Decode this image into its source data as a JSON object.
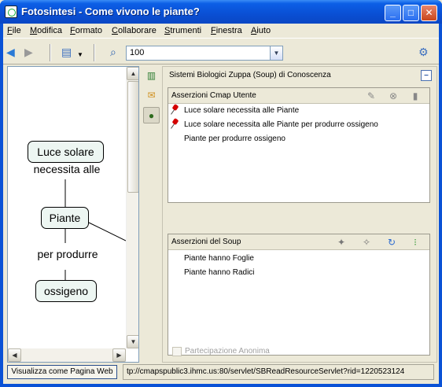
{
  "window": {
    "title": "Fotosintesi - Come vivono le piante?",
    "minimize": "_",
    "maximize": "□",
    "close": "✕"
  },
  "menu": [
    "File",
    "Modifica",
    "Formato",
    "Collaborare",
    "Strumenti",
    "Finestra",
    "Aiuto"
  ],
  "toolbar": {
    "back_icon": "arrow-left-icon",
    "forward_icon": "arrow-right-icon",
    "view_icon": "view-options-icon",
    "zoom_icon": "zoom-icon",
    "zoom_value": "100",
    "dropdown_glyph": "▼",
    "help_icon": "help-icon"
  },
  "map": {
    "nodes": [
      "Luce solare",
      "Piante",
      "ossigeno"
    ],
    "links": [
      "necessita alle",
      "per produrre"
    ]
  },
  "panel": {
    "title": "Sistemi Biologici Zuppa (Soup) di Conoscenza",
    "collapse": "–",
    "user_section": {
      "label": "Asserzioni Cmap Utente",
      "rows": [
        {
          "text": "Luce solare necessita alle Piante",
          "pinned": true
        },
        {
          "text": "Luce solare necessita alle Piante per produrre ossigeno",
          "pinned": true
        },
        {
          "text": "Piante per produrre ossigeno",
          "pinned": false
        }
      ]
    },
    "soup_section": {
      "label": "Asserzioni del Soup",
      "rows": [
        "Piante hanno Foglie",
        "Piante hanno Radici"
      ]
    },
    "anonymous_label": "Partecipazione Anonima"
  },
  "status": {
    "web_button": "Visualizza come Pagina Web",
    "url": "tp://cmapspublic3.ihmc.us:80/servlet/SBReadResourceServlet?rid=1220523124"
  },
  "colors": {
    "titlebar": "#0a4fd4",
    "node_fill": "#edf6f2",
    "pin": "#d40000",
    "chrome": "#ece9d8"
  }
}
